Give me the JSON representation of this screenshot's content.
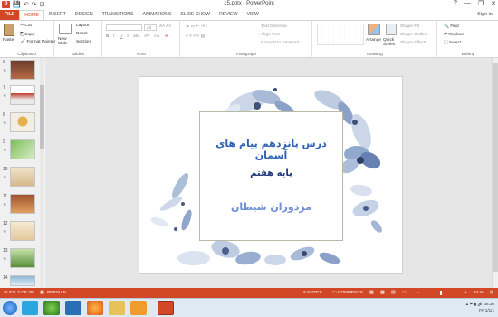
{
  "window": {
    "title": "15.pptx - PowerPoint",
    "help": "?",
    "minimize": "—",
    "restore": "❐",
    "close": "✕"
  },
  "qat": {
    "app_letter": "P",
    "save": "💾",
    "undo": "↶",
    "redo": "↷",
    "start": "⊡"
  },
  "tabs": [
    "FILE",
    "HOME",
    "INSERT",
    "DESIGN",
    "TRANSITIONS",
    "ANIMATIONS",
    "SLIDE SHOW",
    "REVIEW",
    "VIEW"
  ],
  "sign_in": "Sign in",
  "ribbon": {
    "clipboard": {
      "label": "Clipboard",
      "paste": "Paste",
      "cut": "Cut",
      "copy": "Copy",
      "format_painter": "Format Painter"
    },
    "slides": {
      "label": "Slides",
      "new_slide": "New Slide",
      "layout": "Layout",
      "reset": "Reset",
      "section": "Section"
    },
    "font": {
      "label": "Font",
      "font_size": "24",
      "bold": "B",
      "italic": "I",
      "underline": "U",
      "strike": "S",
      "shadow": "abc",
      "spacing": "AV",
      "case": "Aa",
      "color": "A"
    },
    "paragraph": {
      "label": "Paragraph",
      "text_direction": "Text Direction",
      "align_text": "Align Text",
      "smartart": "Convert to SmartArt"
    },
    "drawing": {
      "label": "Drawing",
      "arrange": "Arrange",
      "quick_styles": "Quick Styles",
      "shape_fill": "Shape Fill",
      "shape_outline": "Shape Outline",
      "shape_effects": "Shape Effects"
    },
    "editing": {
      "label": "Editing",
      "find": "Find",
      "replace": "Replace",
      "select": "Select"
    }
  },
  "thumbnails": [
    {
      "num": "6",
      "star": "★"
    },
    {
      "num": "7",
      "star": "★"
    },
    {
      "num": "8",
      "star": "★"
    },
    {
      "num": "9",
      "star": "★"
    },
    {
      "num": "10",
      "star": "★"
    },
    {
      "num": "11",
      "star": "★"
    },
    {
      "num": "12",
      "star": "★"
    },
    {
      "num": "13",
      "star": "★"
    },
    {
      "num": "14",
      "star": ""
    }
  ],
  "slide": {
    "line1": "درس پانزدهم پیام های آسمان",
    "line2": "پایه هفتم",
    "line3": "مزدوران شیطان"
  },
  "status": {
    "slide_of": "SLIDE 2 OF 29",
    "language": "PERSIAN",
    "notes": "NOTES",
    "comments": "COMMENTS",
    "zoom": "74 %",
    "zoom_fraction": 0.45
  },
  "taskbar": {
    "lang": "FA",
    "time": "08:30",
    "date": "1/1/1"
  },
  "colors": {
    "accent": "#d24726",
    "slide_title": "#2f62b5",
    "slide_subtitle": "#1f3a7a",
    "slide_name": "#6d8fd6"
  }
}
